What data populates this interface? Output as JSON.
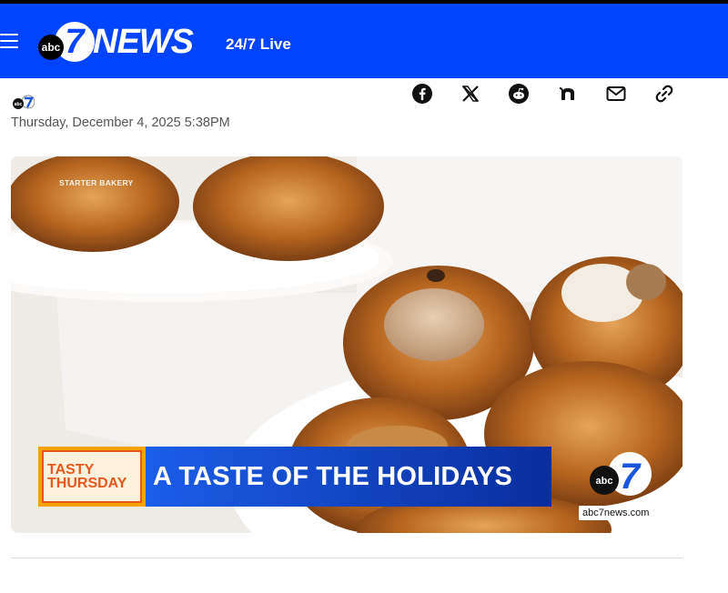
{
  "header": {
    "menu_icon": "hamburger-icon",
    "logo": {
      "abc": "abc",
      "seven": "7",
      "news": "NEWS"
    },
    "live_label": "24/7 Live",
    "bg_color": "#0044ff"
  },
  "byline": {
    "logo_icon": "abc7-logo-icon",
    "date": "Thursday, December 4, 2025 5:38PM"
  },
  "share": [
    {
      "icon": "facebook-icon"
    },
    {
      "icon": "x-icon"
    },
    {
      "icon": "reddit-icon"
    },
    {
      "icon": "nextdoor-icon"
    },
    {
      "icon": "email-icon"
    },
    {
      "icon": "link-icon"
    }
  ],
  "hero": {
    "credit": "STARTER BAKERY",
    "tag_line1": "TASTY",
    "tag_line2": "THURSDAY",
    "headline": "A TASTE OF THE HOLIDAYS",
    "watermark_abc": "abc",
    "watermark_seven": "7",
    "site": "abc7news.com"
  }
}
